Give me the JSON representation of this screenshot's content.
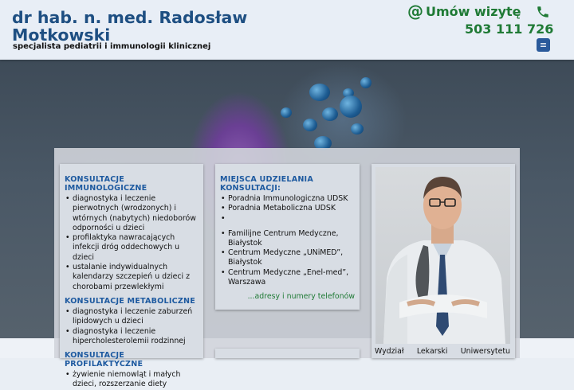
{
  "header": {
    "title": "dr hab. n. med. Radosław Motkowski",
    "subtitle": "specjalista pediatrii i immunologii klinicznej",
    "book_label": "Umów wizytę",
    "phone": "503 111 726",
    "menu_icon": "≡"
  },
  "sections": {
    "left": [
      {
        "heading": "KONSULTACJE IMMUNOLOGICZNE",
        "items": [
          "diagnostyka i leczenie pierwotnych (wrodzonych) i wtórnych (nabytych) niedoborów odporności u dzieci",
          "profilaktyka nawracających infekcji dróg oddechowych u dzieci",
          "ustalanie indywidualnych kalendarzy szczepień u dzieci z chorobami przewlekłymi"
        ]
      },
      {
        "heading": "KONSULTACJE METABOLICZNE",
        "items": [
          "diagnostyka i leczenie zaburzeń lipidowych u dzieci",
          "diagnostyka i leczenie hipercholesterolemii rodzinnej"
        ]
      },
      {
        "heading": "KONSULTACJE PROFILAKTYCZNE",
        "items": [
          "żywienie niemowląt i małych dzieci, rozszerzanie diety"
        ]
      }
    ],
    "middle": {
      "heading": "MIEJSCA UDZIELANIA KONSULTACJI:",
      "items": [
        "Poradnia Immunologiczna UDSK",
        "Poradnia Metaboliczna UDSK",
        "",
        "Familijne Centrum Medyczne, Białystok",
        "Centrum Medyczne „UNiMED”, Białystok",
        "Centrum Medyczne „Enel-med”, Warszawa"
      ],
      "more_link": "...adresy i numery telefonów"
    },
    "photo_caption": [
      "Wydział",
      "Lekarski",
      "Uniwersytetu"
    ]
  }
}
